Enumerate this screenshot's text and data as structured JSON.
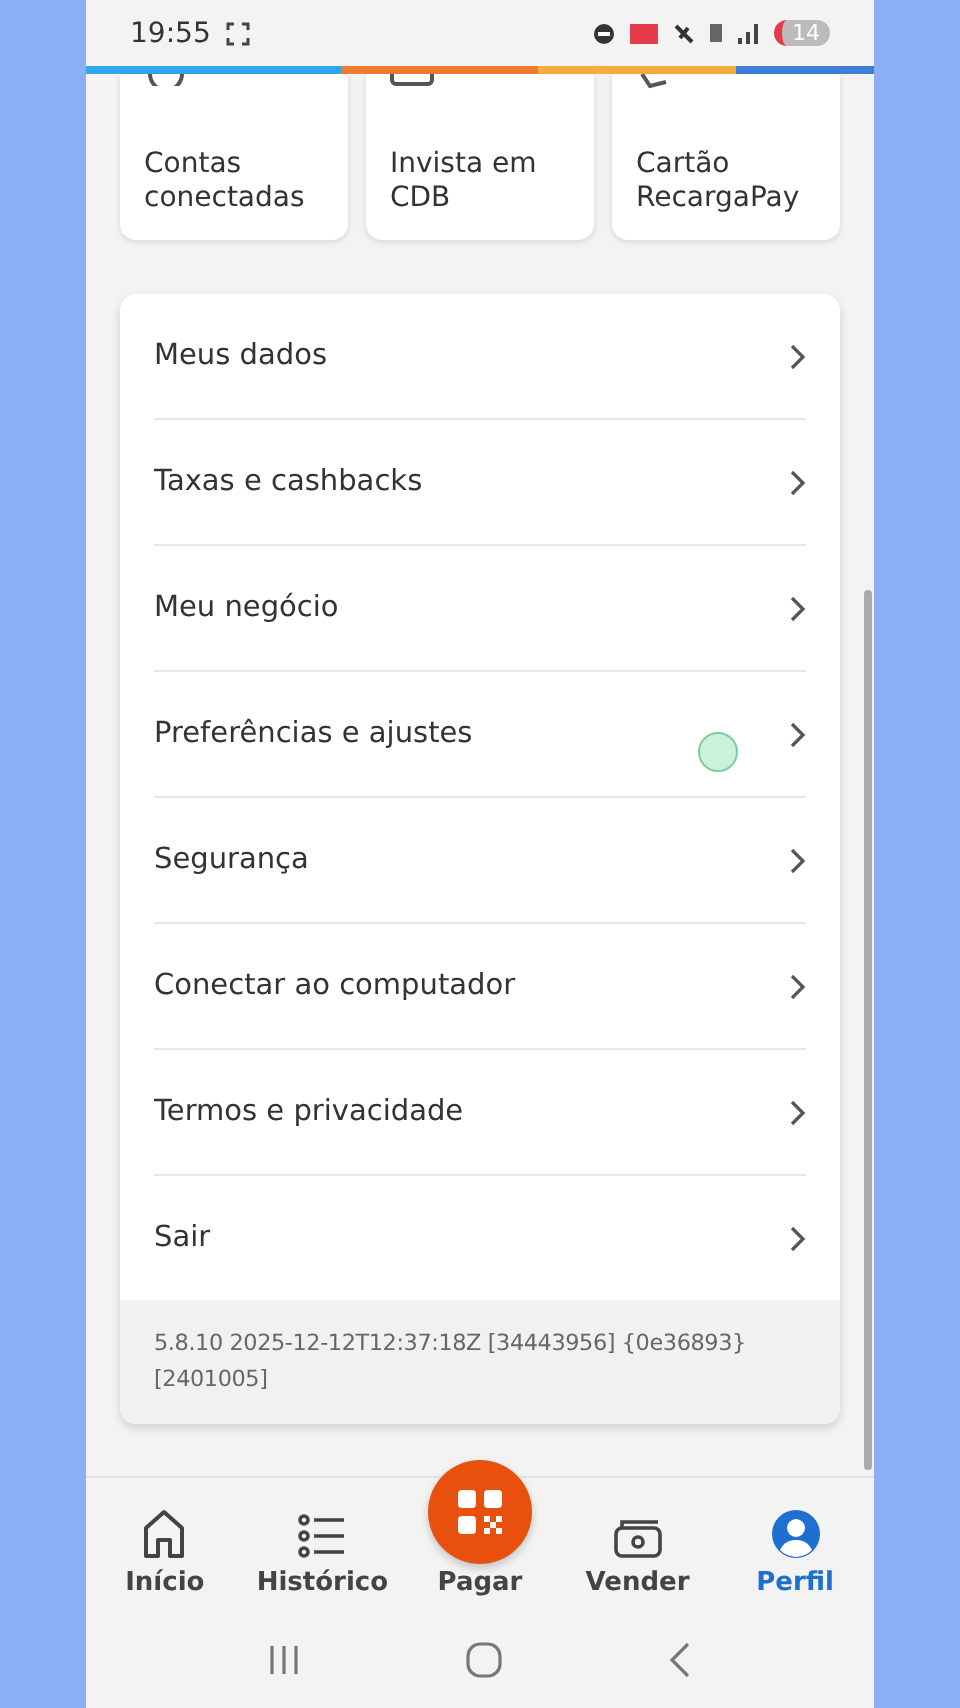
{
  "status_bar": {
    "time": "19:55",
    "battery": "14"
  },
  "shortcuts": [
    {
      "label": "Contas conectadas"
    },
    {
      "label": "Invista em CDB"
    },
    {
      "label": "Cartão RecargaPay"
    }
  ],
  "menu": {
    "items": [
      {
        "label": "Meus dados"
      },
      {
        "label": "Taxas e cashbacks"
      },
      {
        "label": "Meu negócio"
      },
      {
        "label": "Preferências e ajustes"
      },
      {
        "label": "Segurança"
      },
      {
        "label": "Conectar ao computador"
      },
      {
        "label": "Termos e privacidade"
      },
      {
        "label": "Sair"
      }
    ],
    "version": "5.8.10 2025-12-12T12:37:18Z [34443956] {0e36893} [2401005]"
  },
  "bottom_nav": [
    {
      "label": "Início",
      "kind": "tab",
      "selected": false
    },
    {
      "label": "Histórico",
      "kind": "tab",
      "selected": false
    },
    {
      "label": "Pagar",
      "kind": "action",
      "selected": false
    },
    {
      "label": "Vender",
      "kind": "tab",
      "selected": false
    },
    {
      "label": "Perfil",
      "kind": "tab",
      "selected": true
    }
  ]
}
